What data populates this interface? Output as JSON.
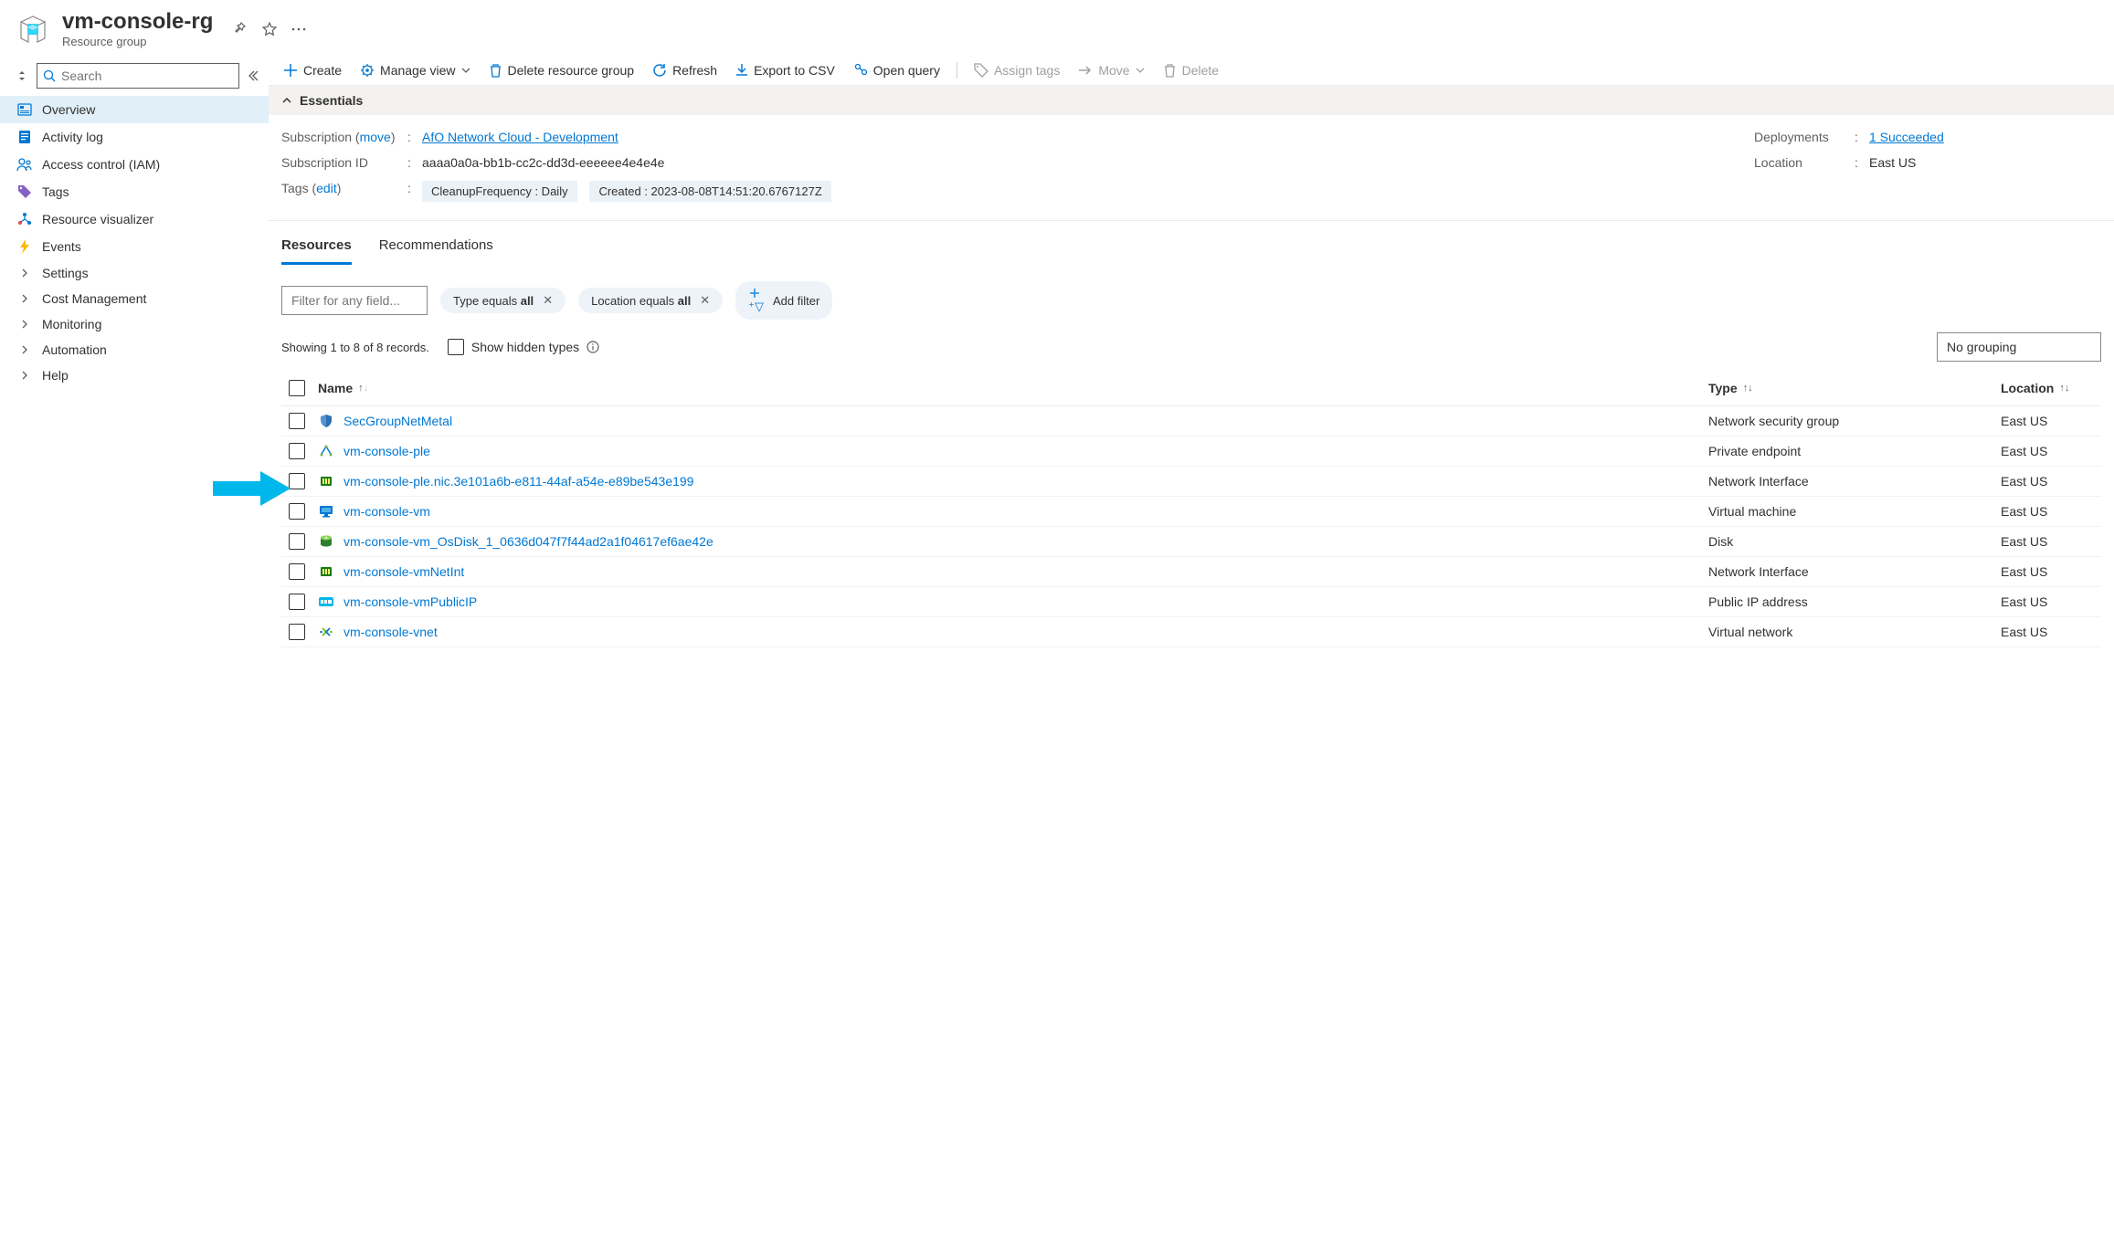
{
  "header": {
    "title": "vm-console-rg",
    "subtitle": "Resource group"
  },
  "sidebar": {
    "search_placeholder": "Search",
    "items": [
      {
        "label": "Overview",
        "icon": "overview"
      },
      {
        "label": "Activity log",
        "icon": "log"
      },
      {
        "label": "Access control (IAM)",
        "icon": "iam"
      },
      {
        "label": "Tags",
        "icon": "tag"
      },
      {
        "label": "Resource visualizer",
        "icon": "visualizer"
      },
      {
        "label": "Events",
        "icon": "events"
      },
      {
        "label": "Settings",
        "icon": "chevron"
      },
      {
        "label": "Cost Management",
        "icon": "chevron"
      },
      {
        "label": "Monitoring",
        "icon": "chevron"
      },
      {
        "label": "Automation",
        "icon": "chevron"
      },
      {
        "label": "Help",
        "icon": "chevron"
      }
    ]
  },
  "toolbar": {
    "create": "Create",
    "manage_view": "Manage view",
    "delete_rg": "Delete resource group",
    "refresh": "Refresh",
    "export": "Export to CSV",
    "open_query": "Open query",
    "assign_tags": "Assign tags",
    "move": "Move",
    "delete": "Delete"
  },
  "essentials": {
    "title": "Essentials",
    "subscription_label": "Subscription",
    "move_link": "move",
    "subscription_value": "AfO Network Cloud - Development",
    "sub_id_label": "Subscription ID",
    "sub_id_value": "aaaa0a0a-bb1b-cc2c-dd3d-eeeeee4e4e4e",
    "tags_label": "Tags",
    "edit_link": "edit",
    "tag1": "CleanupFrequency : Daily",
    "tag2": "Created : 2023-08-08T14:51:20.6767127Z",
    "deployments_label": "Deployments",
    "deployments_value": "1 Succeeded",
    "location_label": "Location",
    "location_value": "East US"
  },
  "tabs": {
    "resources": "Resources",
    "recommendations": "Recommendations"
  },
  "filter": {
    "placeholder": "Filter for any field...",
    "type_prefix": "Type equals ",
    "type_value": "all",
    "loc_prefix": "Location equals ",
    "loc_value": "all",
    "add": "Add filter"
  },
  "records": {
    "text": "Showing 1 to 8 of 8 records.",
    "show_hidden": "Show hidden types",
    "grouping": "No grouping"
  },
  "columns": {
    "name": "Name",
    "type": "Type",
    "location": "Location"
  },
  "resources": [
    {
      "name": "SecGroupNetMetal",
      "type": "Network security group",
      "location": "East US",
      "icon": "shield"
    },
    {
      "name": "vm-console-ple",
      "type": "Private endpoint",
      "location": "East US",
      "icon": "endpoint"
    },
    {
      "name": "vm-console-ple.nic.3e101a6b-e811-44af-a54e-e89be543e199",
      "type": "Network Interface",
      "location": "East US",
      "icon": "nic"
    },
    {
      "name": "vm-console-vm",
      "type": "Virtual machine",
      "location": "East US",
      "icon": "vm"
    },
    {
      "name": "vm-console-vm_OsDisk_1_0636d047f7f44ad2a1f04617ef6ae42e",
      "type": "Disk",
      "location": "East US",
      "icon": "disk"
    },
    {
      "name": "vm-console-vmNetInt",
      "type": "Network Interface",
      "location": "East US",
      "icon": "nic"
    },
    {
      "name": "vm-console-vmPublicIP",
      "type": "Public IP address",
      "location": "East US",
      "icon": "pip"
    },
    {
      "name": "vm-console-vnet",
      "type": "Virtual network",
      "location": "East US",
      "icon": "vnet"
    }
  ]
}
